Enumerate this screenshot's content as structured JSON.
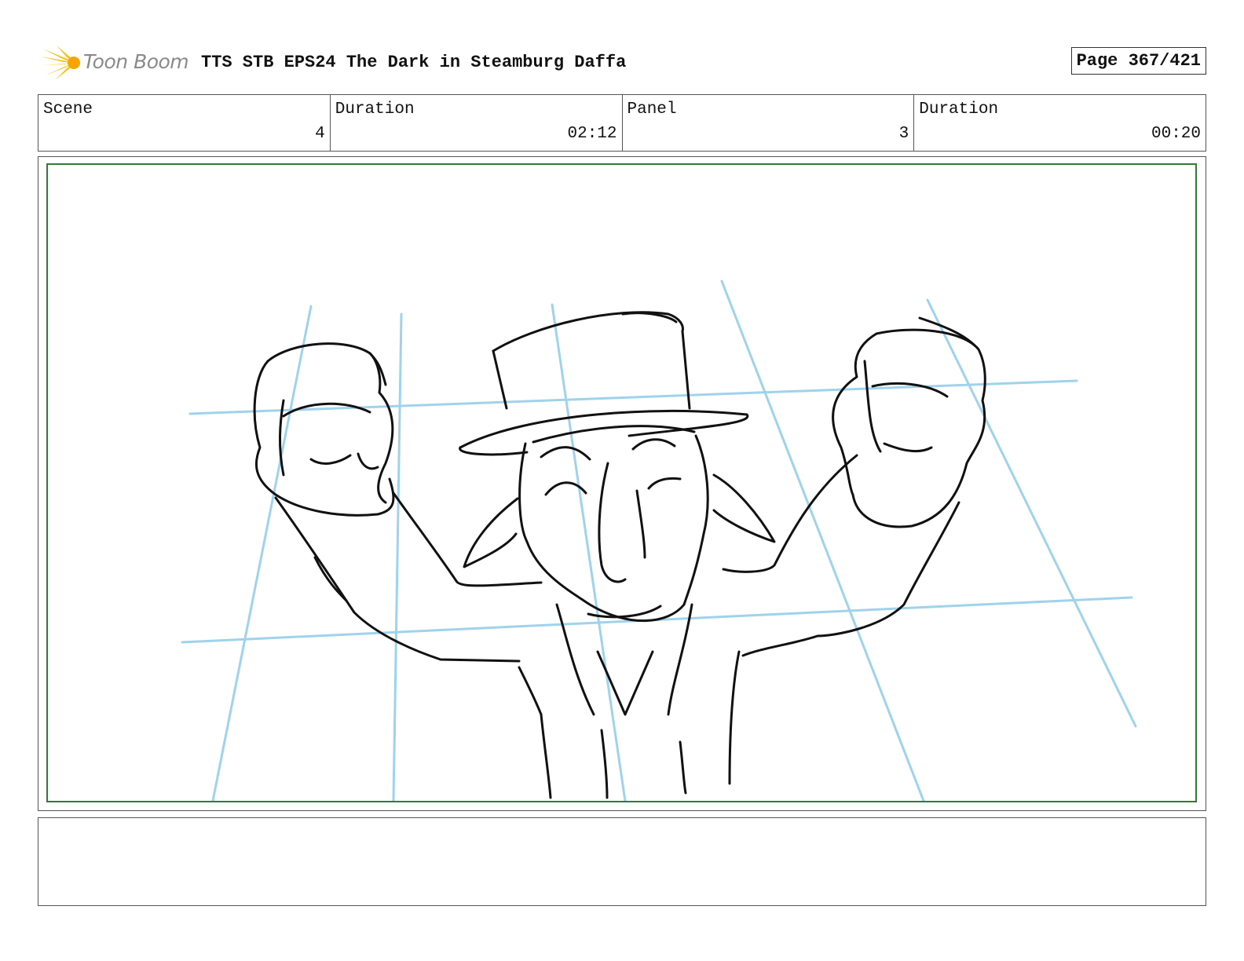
{
  "header": {
    "logo_text": "Toon Boom",
    "title": "TTS STB EPS24 The Dark in Steamburg Daffa",
    "page": "Page 367/421"
  },
  "info": [
    {
      "label": "Scene",
      "value": "4"
    },
    {
      "label": "Duration",
      "value": "02:12"
    },
    {
      "label": "Panel",
      "value": "3"
    },
    {
      "label": "Duration",
      "value": "00:20"
    }
  ],
  "notes": {
    "text": ""
  },
  "colors": {
    "frame_border": "#2e7d32",
    "guide_lines": "#9fd3ec",
    "sketch": "#111111",
    "logo_star": "#f5c518"
  }
}
